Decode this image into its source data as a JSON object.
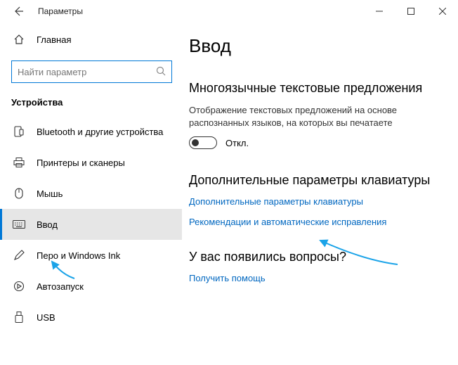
{
  "window": {
    "title": "Параметры"
  },
  "sidebar": {
    "home_label": "Главная",
    "search_placeholder": "Найти параметр",
    "section_label": "Устройства",
    "items": [
      {
        "icon": "bluetooth",
        "label": "Bluetooth и другие устройства"
      },
      {
        "icon": "printer",
        "label": "Принтеры и сканеры"
      },
      {
        "icon": "mouse",
        "label": "Мышь"
      },
      {
        "icon": "keyboard",
        "label": "Ввод"
      },
      {
        "icon": "pen",
        "label": "Перо и Windows Ink"
      },
      {
        "icon": "autoplay",
        "label": "Автозапуск"
      },
      {
        "icon": "usb",
        "label": "USB"
      }
    ]
  },
  "main": {
    "page_title": "Ввод",
    "section1_heading": "Многоязычные текстовые предложения",
    "section1_body": "Отображение текстовых предложений на основе распознанных языков, на которых вы печатаете",
    "toggle_label": "Откл.",
    "section2_heading": "Дополнительные параметры клавиатуры",
    "link_adv_keyboard": "Дополнительные параметры клавиатуры",
    "link_autocorrect": "Рекомендации и автоматические исправления",
    "section3_heading": "У вас появились вопросы?",
    "link_help": "Получить помощь"
  }
}
